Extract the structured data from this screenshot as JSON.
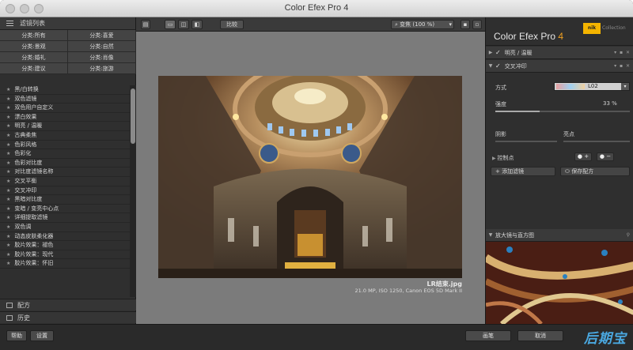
{
  "window": {
    "title": "Color Efex Pro 4"
  },
  "left_panel": {
    "header": "滤镜列表",
    "categories": [
      "分类:所有",
      "分类:喜爱",
      "分类:景观",
      "分类:自然",
      "分类:婚礼",
      "分类:肖像",
      "分类:建议",
      "分类:旅游"
    ],
    "filters": [
      "黑/白转换",
      "双色滤镜",
      "双色用户自定义",
      "漂白效果",
      "明亮 / 温暖",
      "古典柔焦",
      "色彩风格",
      "色彩化",
      "色彩对比度",
      "对比度滤镜名称",
      "交叉平衡",
      "交叉冲印",
      "黑暗对比度",
      "变暗 / 变亮中心点",
      "详细提取滤镜",
      "双色调",
      "动态皮肤柔化器",
      "胶片效果：褪色",
      "胶片效果：现代",
      "胶片效果：怀旧"
    ],
    "recipes_label": "配方",
    "history_label": "历史"
  },
  "toolbar": {
    "compare_label": "比较",
    "zoom_label": "变焦 (100 %)"
  },
  "image": {
    "filename": "LR结束.jpg",
    "meta": "21.0 MP, ISO 1250, Canon EOS 5D Mark II"
  },
  "right_panel": {
    "app_name": "Color Efex Pro",
    "app_version": "4",
    "brand_badge": "nik",
    "brand_collection": "Collection",
    "filter1_name": "明亮 / 温暖",
    "filter2_name": "交叉冲印",
    "method_label": "方式",
    "method_value": "L02",
    "strength_label": "强度",
    "strength_value": "33 %",
    "strength_fraction": 0.33,
    "shadows_label": "阴影",
    "highlights_label": "亮点",
    "control_points_label": "控制点",
    "add_filter_label": "添加滤镜",
    "save_recipe_label": "保存配方",
    "loupe_label": "放大镜与直方图"
  },
  "bottom_bar": {
    "help_label": "帮助",
    "settings_label": "设置",
    "brush_label": "画笔",
    "cancel_label": "取消",
    "watermark": "后期宝"
  }
}
